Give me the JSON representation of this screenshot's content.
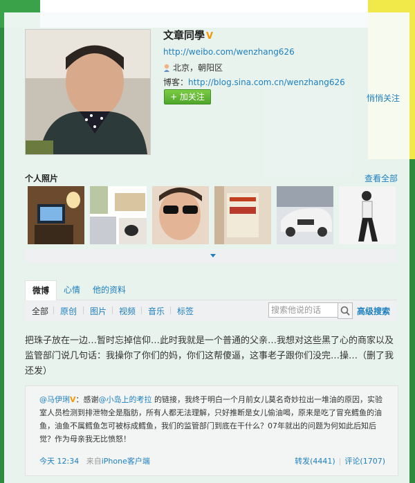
{
  "profile": {
    "name": "文章同學",
    "verified_mark": "V",
    "url": "http://weibo.com/wenzhang626",
    "location": "北京，朝阳区",
    "blog_label": "博客：",
    "blog_url": "http://blog.sina.com.cn/wenzhang626",
    "follow_button": "+ 加关注",
    "quiet_follow": "悄悄关注"
  },
  "photos": {
    "title": "个人照片",
    "view_all": "查看全部"
  },
  "tabs": [
    "微博",
    "心情",
    "他的资料"
  ],
  "filters": [
    "全部",
    "原创",
    "图片",
    "视频",
    "音乐",
    "标签"
  ],
  "search": {
    "placeholder": "搜索他说的话",
    "advanced": "高级搜索"
  },
  "post": {
    "text": "把珠子放在一边…暂时忘掉信仰…此时我就是一个普通的父亲…我想对这些黑了心的商家以及监管部门说几句话：我操你了你们的妈，你们这帮傻逼，这事老子跟你们没完…操…（删了我还发）"
  },
  "retweet": {
    "author": "@马伊琍",
    "verified_mark": "V",
    "colon": "：",
    "text_before": "感谢",
    "mention": "@小岛上的考拉",
    "text_after": " 的链接，我终于明白一个月前女儿莫名奇妙拉出一堆油的原因，实验室人员检测到排泄物全是脂肪，所有人都无法理解，只好推断是女儿偷油喝，原来是吃了冒充鳕鱼的油鱼，油鱼不属鳕鱼怎可被标成鳕鱼，我们的监管部门到底在干什么？07年就出的问题为何如此后知后觉？作为母亲我无比愤怒！",
    "time": "今天 12:34",
    "source_prefix": "来自",
    "source": "iPhone客户端",
    "repost": "转发(4441)",
    "separator": "|",
    "comment": "评论(1707)"
  },
  "colors": {
    "link": "#1c7fbf",
    "verified": "#f39800",
    "follow_green": "#5cb532",
    "background_green": "#2e8a3f"
  }
}
